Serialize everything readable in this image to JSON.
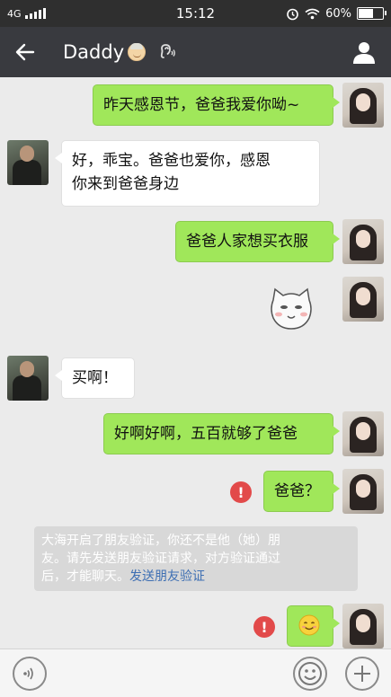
{
  "status_bar": {
    "network": "4G",
    "time": "15:12",
    "battery_percent_label": "60%",
    "battery_level": 0.6
  },
  "header": {
    "contact_name": "Daddy",
    "icons": [
      "back-arrow-icon",
      "earpiece-icon",
      "profile-icon"
    ]
  },
  "messages": [
    {
      "sender": "me",
      "text": "昨天感恩节，爸爸我爱你呦~"
    },
    {
      "sender": "dad",
      "text_line1": "好，乖宝。爸爸也爱你，感恩",
      "text_line2": "你来到爸爸身边"
    },
    {
      "sender": "me",
      "text": "爸爸人家想买衣服"
    },
    {
      "sender": "me",
      "type": "sticker",
      "sticker": "cat-face-sticker"
    },
    {
      "sender": "dad",
      "text": "买啊！"
    },
    {
      "sender": "me",
      "text": "好啊好啊，五百就够了爸爸"
    },
    {
      "sender": "me",
      "text": "爸爸？",
      "failed": true,
      "error_glyph": "!"
    },
    {
      "sender": "me",
      "type": "emoji",
      "emoji": "smile-emoji",
      "failed": true,
      "error_glyph": "!"
    }
  ],
  "system_notice": {
    "line1": "大海开启了朋友验证，你还不是他（她）朋",
    "line2": "友。请先发送朋友验证请求，对方验证通过",
    "line3_prefix": "后，才能聊天。",
    "link_text": "发送朋友验证"
  },
  "input_bar": {
    "icons": [
      "voice-icon",
      "emoji-icon",
      "plus-icon"
    ]
  },
  "colors": {
    "my_bubble": "#a0e75a",
    "dad_bubble": "#ffffff",
    "header_bg": "#393a3f",
    "error": "#e24a4a",
    "link": "#3e6fb3"
  }
}
